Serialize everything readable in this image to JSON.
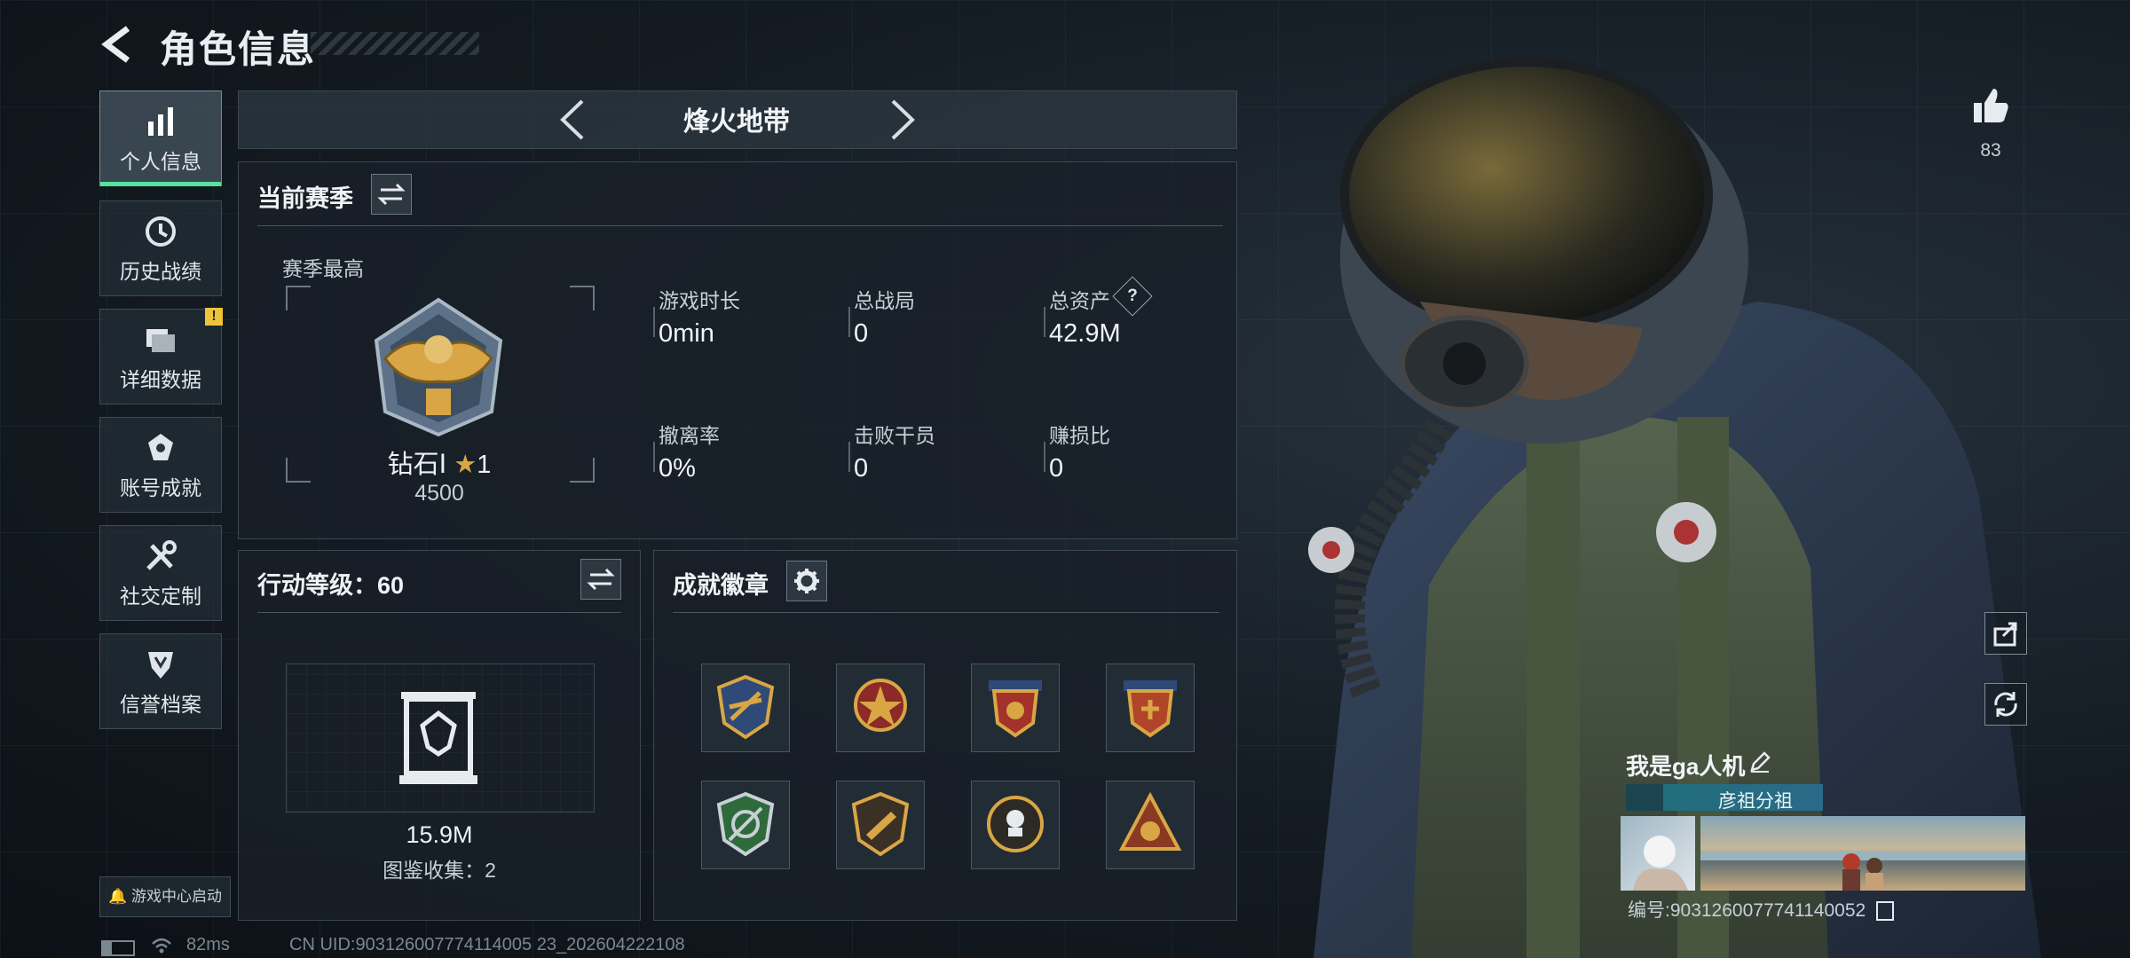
{
  "header": {
    "title": "角色信息"
  },
  "sidebar": {
    "items": [
      {
        "label": "个人信息",
        "icon": "bar-chart-icon",
        "active": true
      },
      {
        "label": "历史战绩",
        "icon": "history-clock-icon"
      },
      {
        "label": "详细数据",
        "icon": "folder-icon",
        "badge": "!"
      },
      {
        "label": "账号成就",
        "icon": "achievement-icon"
      },
      {
        "label": "社交定制",
        "icon": "tools-icon"
      },
      {
        "label": "信誉档案",
        "icon": "credit-shield-icon"
      }
    ],
    "launch_label": "游戏中心启动"
  },
  "mode_selector": {
    "label": "烽火地带"
  },
  "season": {
    "title": "当前赛季",
    "best_label": "赛季最高",
    "rank_name": "钻石Ⅰ",
    "rank_stars": "1",
    "rank_score": "4500",
    "stats": [
      {
        "key": "游戏时长",
        "value": "0min"
      },
      {
        "key": "总战局",
        "value": "0"
      },
      {
        "key": "总资产",
        "value": "42.9M",
        "help": "?"
      },
      {
        "key": "撤离率",
        "value": "0%"
      },
      {
        "key": "击败干员",
        "value": "0"
      },
      {
        "key": "赚损比",
        "value": "0"
      }
    ]
  },
  "action_level": {
    "title": "行动等级：60",
    "value": "15.9M",
    "collection": "图鉴收集：2"
  },
  "achievements": {
    "title": "成就徽章",
    "medals": [
      "medal-1",
      "medal-2",
      "medal-3",
      "medal-4",
      "medal-5",
      "medal-6",
      "medal-7",
      "medal-8"
    ]
  },
  "profile": {
    "likes": "83",
    "nickname": "我是ga人机",
    "tag": "彦祖分祖",
    "id_text": "编号:9031260077741140052"
  },
  "status": {
    "ping": "82ms",
    "uid": "CN UID:903126007774114005 23_202604222108"
  },
  "colors": {
    "accent": "#57e0a0",
    "badge": "#f0c43a",
    "gold": "#d9a645"
  }
}
